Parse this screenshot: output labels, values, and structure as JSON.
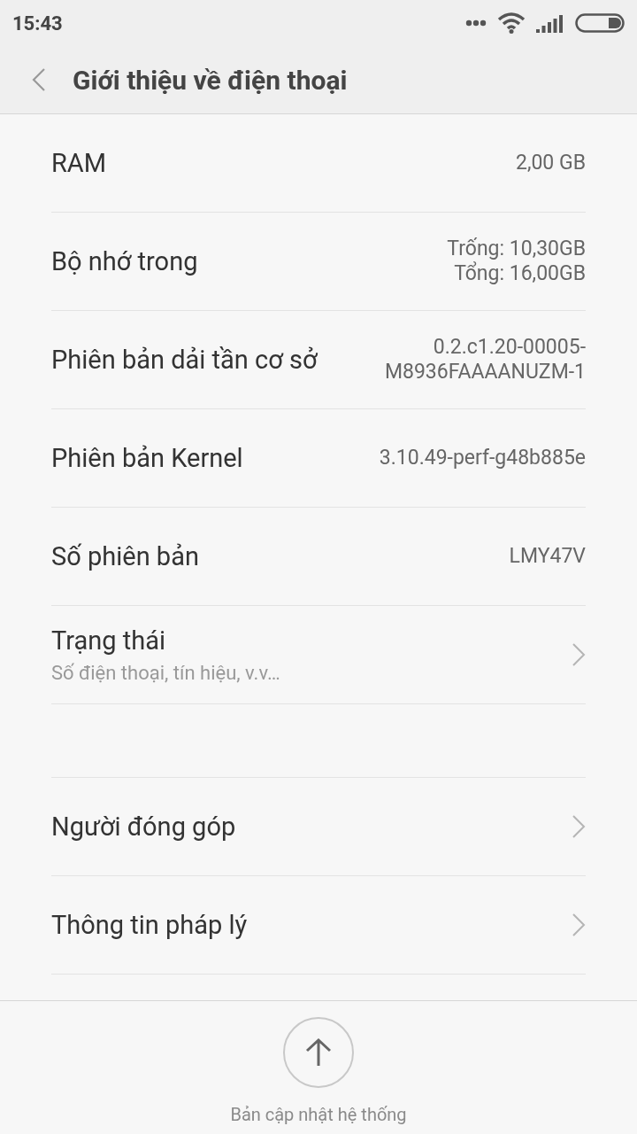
{
  "status_bar": {
    "time": "15:43"
  },
  "header": {
    "title": "Giới thiệu về điện thoại"
  },
  "groups": [
    {
      "items": [
        {
          "kind": "info",
          "title": "RAM",
          "value": [
            "2,00 GB"
          ]
        },
        {
          "kind": "info",
          "title": "Bộ nhớ trong",
          "value": [
            "Trống: 10,30GB",
            "Tổng: 16,00GB"
          ]
        },
        {
          "kind": "info",
          "title": "Phiên bản dải tần cơ sở",
          "value": [
            "0.2.c1.20-00005-",
            "M8936FAAAANUZM-1"
          ]
        },
        {
          "kind": "info",
          "title": "Phiên bản Kernel",
          "value": [
            "3.10.49-perf-g48b885e"
          ]
        },
        {
          "kind": "info",
          "title": "Số phiên bản",
          "value": [
            "LMY47V"
          ]
        },
        {
          "kind": "link",
          "title": "Trạng thái",
          "subtitle": "Số điện thoại, tín hiệu, v.v…"
        }
      ]
    },
    {
      "items": [
        {
          "kind": "link",
          "title": "Người đóng góp"
        },
        {
          "kind": "link",
          "title": "Thông tin pháp lý"
        }
      ]
    }
  ],
  "footer": {
    "update_label": "Bản cập nhật hệ thống"
  }
}
